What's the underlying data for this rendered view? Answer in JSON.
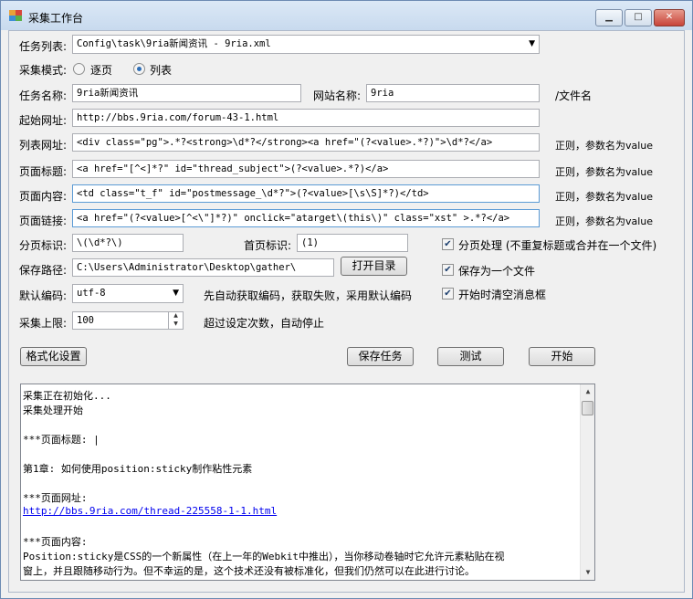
{
  "window": {
    "title": "采集工作台",
    "minimize": "▁",
    "maximize": "□",
    "close": "✕"
  },
  "form": {
    "task_list_label": "任务列表:",
    "task_list_value": "Config\\task\\9ria新闻资讯 - 9ria.xml",
    "mode_label": "采集模式:",
    "mode_options": [
      "逐页",
      "列表"
    ],
    "mode_selected": "列表",
    "task_name_label": "任务名称:",
    "task_name_value": "9ria新闻资讯",
    "site_name_label": "网站名称:",
    "site_name_value": "9ria",
    "file_name_suffix": "/文件名",
    "start_url_label": "起始网址:",
    "start_url_value": "http://bbs.9ria.com/forum-43-1.html",
    "list_url_label": "列表网址:",
    "list_url_value": "<div class=\"pg\">.*?<strong>\\d*?</strong><a href=\"(?<value>.*?)\">\\d*?</a>",
    "page_title_label": "页面标题:",
    "page_title_value": "<a href=\"[^<]*?\" id=\"thread_subject\">(?<value>.*?)</a>",
    "page_content_label": "页面内容:",
    "page_content_value": "<td class=\"t_f\" id=\"postmessage_\\d*?\">(?<value>[\\s\\S]*?)</td>",
    "page_link_label": "页面链接:",
    "page_link_value": "<a href=\"(?<value>[^<\\\"]*?)\" onclick=\"atarget\\(this\\)\" class=\"xst\" >.*?</a>",
    "regex_note": "正则，参数名为value",
    "pagination_label": "分页标识:",
    "pagination_value": "\\(\\d*?\\)",
    "first_page_label": "首页标识:",
    "first_page_value": "(1)",
    "save_path_label": "保存路径:",
    "save_path_value": "C:\\Users\\Administrator\\Desktop\\gather\\",
    "open_dir_button": "打开目录",
    "encoding_label": "默认编码:",
    "encoding_value": "utf-8",
    "encoding_note": "先自动获取编码，获取失败，采用默认编码",
    "limit_label": "采集上限:",
    "limit_value": "100",
    "limit_note": "超过设定次数，自动停止",
    "checkboxes": [
      {
        "label": "分页处理 (不重复标题或合并在一个文件)",
        "checked": true
      },
      {
        "label": "保存为一个文件",
        "checked": true
      },
      {
        "label": "开始时清空消息框",
        "checked": true
      }
    ]
  },
  "buttons": {
    "format": "格式化设置",
    "save_task": "保存任务",
    "test": "测试",
    "start": "开始"
  },
  "log": {
    "lines": [
      "采集正在初始化...",
      "采集处理开始",
      "",
      "***页面标题: |",
      "",
      "第1章: 如何使用position:sticky制作粘性元素",
      "",
      "***页面网址:",
      "http://bbs.9ria.com/thread-225558-1-1.html",
      "",
      "***页面内容:",
      "        Position:sticky是CSS的一个新属性（在上一年的Webkit中推出），当你移动卷轴时它允许元素粘贴在视",
      "窗上，并且跟随移动行为。但不幸运的是，这个技术还没有被标准化，但我们仍然可以在此进行讨论。"
    ]
  }
}
